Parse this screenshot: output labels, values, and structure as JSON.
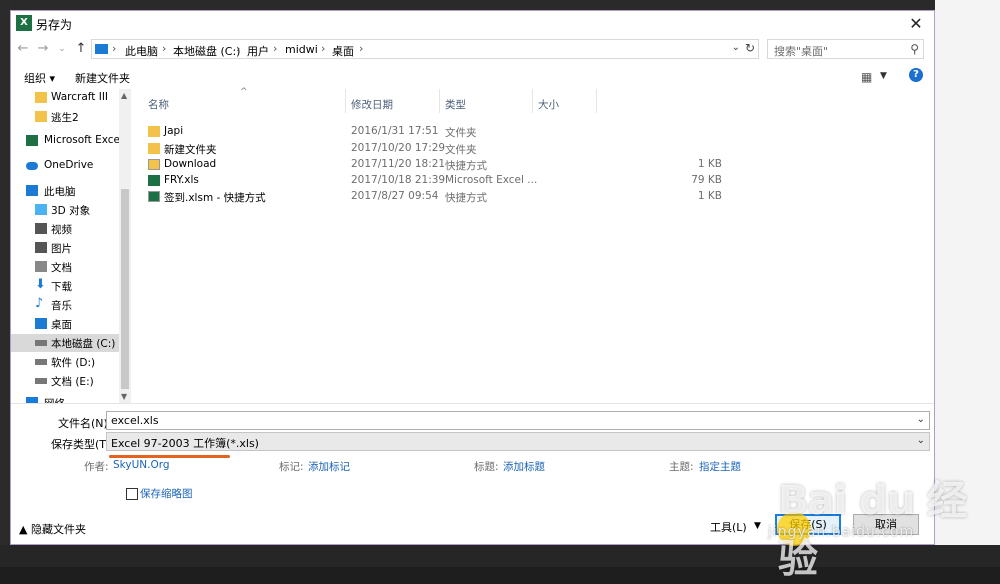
{
  "window": {
    "title": "另存为",
    "app_icon_letter": "X"
  },
  "nav": {
    "breadcrumbs": [
      "此电脑",
      "本地磁盘 (C:)",
      "用户",
      "midwi",
      "桌面"
    ],
    "search_placeholder": "搜索\"桌面\""
  },
  "toolbar": {
    "organize": "组织 ▾",
    "new_folder": "新建文件夹",
    "help": "?"
  },
  "nav_pane": {
    "items": [
      {
        "label": "Warcraft III",
        "icon": "folder-icon",
        "color": "#f2c24b"
      },
      {
        "label": "逃生2",
        "icon": "folder-icon",
        "color": "#f2c24b"
      },
      {
        "label": "Microsoft Excel",
        "icon": "excel-icon",
        "color": "#1d7044"
      },
      {
        "label": "OneDrive",
        "icon": "cloud-icon",
        "color": "#1b7bd4"
      },
      {
        "label": "此电脑",
        "icon": "computer-icon",
        "color": "#1b7bd4"
      },
      {
        "label": "3D 对象",
        "icon": "cube-icon",
        "color": "#4ab3f0"
      },
      {
        "label": "视频",
        "icon": "video-icon",
        "color": "#555555"
      },
      {
        "label": "图片",
        "icon": "picture-icon",
        "color": "#555555"
      },
      {
        "label": "文档",
        "icon": "document-icon",
        "color": "#666666"
      },
      {
        "label": "下载",
        "icon": "download-icon",
        "color": "#1b7bd4"
      },
      {
        "label": "音乐",
        "icon": "music-icon",
        "color": "#1b7bd4"
      },
      {
        "label": "桌面",
        "icon": "desktop-icon",
        "color": "#1b7bd4"
      },
      {
        "label": "本地磁盘 (C:)",
        "icon": "drive-icon",
        "color": "#555555",
        "selected": true
      },
      {
        "label": "软件 (D:)",
        "icon": "drive-icon",
        "color": "#555555"
      },
      {
        "label": "文档 (E:)",
        "icon": "drive-icon",
        "color": "#555555"
      },
      {
        "label": "网络",
        "icon": "network-icon",
        "color": "#1b7bd4"
      }
    ]
  },
  "file_list": {
    "columns": [
      "名称",
      "修改日期",
      "类型",
      "大小"
    ],
    "rows": [
      {
        "name": "Japi",
        "date": "2016/1/31 17:51",
        "type": "文件夹",
        "size": "",
        "icon": "folder-icon"
      },
      {
        "name": "新建文件夹",
        "date": "2017/10/20 17:29",
        "type": "文件夹",
        "size": "",
        "icon": "folder-icon"
      },
      {
        "name": "Download",
        "date": "2017/11/20 18:21",
        "type": "快捷方式",
        "size": "1 KB",
        "icon": "shortcut-icon"
      },
      {
        "name": "FRY.xls",
        "date": "2017/10/18 21:39",
        "type": "Microsoft Excel ...",
        "size": "79 KB",
        "icon": "excel-file-icon"
      },
      {
        "name": "签到.xlsm - 快捷方式",
        "date": "2017/8/27 09:54",
        "type": "快捷方式",
        "size": "1 KB",
        "icon": "excel-shortcut-icon"
      }
    ]
  },
  "form": {
    "filename_label": "文件名(N):",
    "filename_value": "excel.xls",
    "filetype_label": "保存类型(T):",
    "filetype_value": "Excel 97-2003 工作簿(*.xls)",
    "authors_label": "作者:",
    "authors_value": "SkyUN.Org",
    "tags_label": "标记:",
    "tags_value": "添加标记",
    "title_label": "标题:",
    "title_value": "添加标题",
    "subject_label": "主题:",
    "subject_value": "指定主题",
    "thumbnail_label": "保存缩略图"
  },
  "footer": {
    "hide_folders": "隐藏文件夹",
    "tools": "工具(L)",
    "save": "保存(S)",
    "cancel": "取消"
  },
  "watermark": {
    "brand": "Bai du 经验",
    "url": "jingyan.baidu.com"
  }
}
